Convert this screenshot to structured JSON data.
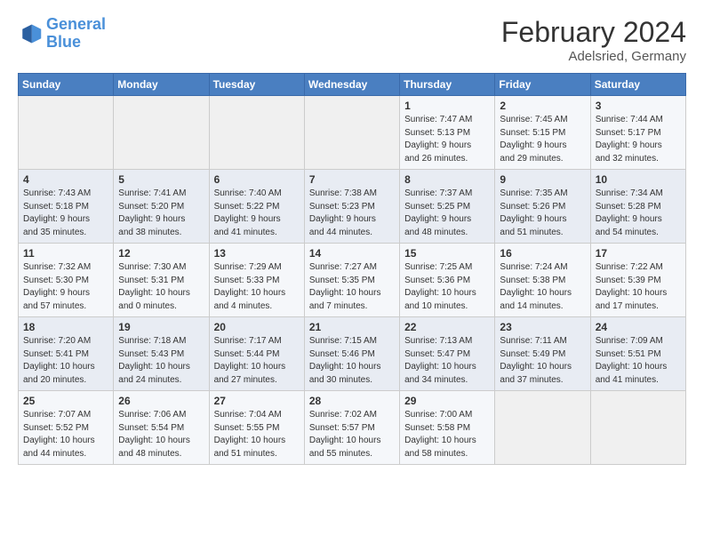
{
  "logo": {
    "line1": "General",
    "line2": "Blue"
  },
  "title": "February 2024",
  "location": "Adelsried, Germany",
  "days_of_week": [
    "Sunday",
    "Monday",
    "Tuesday",
    "Wednesday",
    "Thursday",
    "Friday",
    "Saturday"
  ],
  "weeks": [
    [
      {
        "num": "",
        "info": ""
      },
      {
        "num": "",
        "info": ""
      },
      {
        "num": "",
        "info": ""
      },
      {
        "num": "",
        "info": ""
      },
      {
        "num": "1",
        "info": "Sunrise: 7:47 AM\nSunset: 5:13 PM\nDaylight: 9 hours\nand 26 minutes."
      },
      {
        "num": "2",
        "info": "Sunrise: 7:45 AM\nSunset: 5:15 PM\nDaylight: 9 hours\nand 29 minutes."
      },
      {
        "num": "3",
        "info": "Sunrise: 7:44 AM\nSunset: 5:17 PM\nDaylight: 9 hours\nand 32 minutes."
      }
    ],
    [
      {
        "num": "4",
        "info": "Sunrise: 7:43 AM\nSunset: 5:18 PM\nDaylight: 9 hours\nand 35 minutes."
      },
      {
        "num": "5",
        "info": "Sunrise: 7:41 AM\nSunset: 5:20 PM\nDaylight: 9 hours\nand 38 minutes."
      },
      {
        "num": "6",
        "info": "Sunrise: 7:40 AM\nSunset: 5:22 PM\nDaylight: 9 hours\nand 41 minutes."
      },
      {
        "num": "7",
        "info": "Sunrise: 7:38 AM\nSunset: 5:23 PM\nDaylight: 9 hours\nand 44 minutes."
      },
      {
        "num": "8",
        "info": "Sunrise: 7:37 AM\nSunset: 5:25 PM\nDaylight: 9 hours\nand 48 minutes."
      },
      {
        "num": "9",
        "info": "Sunrise: 7:35 AM\nSunset: 5:26 PM\nDaylight: 9 hours\nand 51 minutes."
      },
      {
        "num": "10",
        "info": "Sunrise: 7:34 AM\nSunset: 5:28 PM\nDaylight: 9 hours\nand 54 minutes."
      }
    ],
    [
      {
        "num": "11",
        "info": "Sunrise: 7:32 AM\nSunset: 5:30 PM\nDaylight: 9 hours\nand 57 minutes."
      },
      {
        "num": "12",
        "info": "Sunrise: 7:30 AM\nSunset: 5:31 PM\nDaylight: 10 hours\nand 0 minutes."
      },
      {
        "num": "13",
        "info": "Sunrise: 7:29 AM\nSunset: 5:33 PM\nDaylight: 10 hours\nand 4 minutes."
      },
      {
        "num": "14",
        "info": "Sunrise: 7:27 AM\nSunset: 5:35 PM\nDaylight: 10 hours\nand 7 minutes."
      },
      {
        "num": "15",
        "info": "Sunrise: 7:25 AM\nSunset: 5:36 PM\nDaylight: 10 hours\nand 10 minutes."
      },
      {
        "num": "16",
        "info": "Sunrise: 7:24 AM\nSunset: 5:38 PM\nDaylight: 10 hours\nand 14 minutes."
      },
      {
        "num": "17",
        "info": "Sunrise: 7:22 AM\nSunset: 5:39 PM\nDaylight: 10 hours\nand 17 minutes."
      }
    ],
    [
      {
        "num": "18",
        "info": "Sunrise: 7:20 AM\nSunset: 5:41 PM\nDaylight: 10 hours\nand 20 minutes."
      },
      {
        "num": "19",
        "info": "Sunrise: 7:18 AM\nSunset: 5:43 PM\nDaylight: 10 hours\nand 24 minutes."
      },
      {
        "num": "20",
        "info": "Sunrise: 7:17 AM\nSunset: 5:44 PM\nDaylight: 10 hours\nand 27 minutes."
      },
      {
        "num": "21",
        "info": "Sunrise: 7:15 AM\nSunset: 5:46 PM\nDaylight: 10 hours\nand 30 minutes."
      },
      {
        "num": "22",
        "info": "Sunrise: 7:13 AM\nSunset: 5:47 PM\nDaylight: 10 hours\nand 34 minutes."
      },
      {
        "num": "23",
        "info": "Sunrise: 7:11 AM\nSunset: 5:49 PM\nDaylight: 10 hours\nand 37 minutes."
      },
      {
        "num": "24",
        "info": "Sunrise: 7:09 AM\nSunset: 5:51 PM\nDaylight: 10 hours\nand 41 minutes."
      }
    ],
    [
      {
        "num": "25",
        "info": "Sunrise: 7:07 AM\nSunset: 5:52 PM\nDaylight: 10 hours\nand 44 minutes."
      },
      {
        "num": "26",
        "info": "Sunrise: 7:06 AM\nSunset: 5:54 PM\nDaylight: 10 hours\nand 48 minutes."
      },
      {
        "num": "27",
        "info": "Sunrise: 7:04 AM\nSunset: 5:55 PM\nDaylight: 10 hours\nand 51 minutes."
      },
      {
        "num": "28",
        "info": "Sunrise: 7:02 AM\nSunset: 5:57 PM\nDaylight: 10 hours\nand 55 minutes."
      },
      {
        "num": "29",
        "info": "Sunrise: 7:00 AM\nSunset: 5:58 PM\nDaylight: 10 hours\nand 58 minutes."
      },
      {
        "num": "",
        "info": ""
      },
      {
        "num": "",
        "info": ""
      }
    ]
  ]
}
